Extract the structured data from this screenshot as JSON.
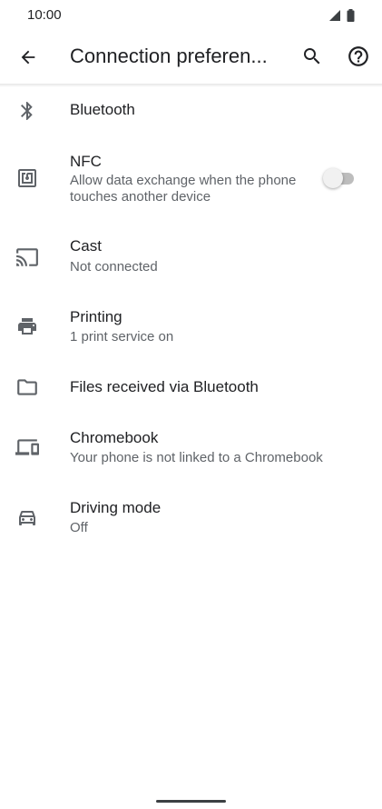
{
  "status_bar": {
    "time": "10:00"
  },
  "app_bar": {
    "title": "Connection preferen..."
  },
  "items": [
    {
      "title": "Bluetooth",
      "icon": "bluetooth-icon"
    },
    {
      "title": "NFC",
      "subtitle": "Allow data exchange when the phone touches another device",
      "icon": "nfc-icon",
      "toggle_on": false
    },
    {
      "title": "Cast",
      "subtitle": "Not connected",
      "icon": "cast-icon"
    },
    {
      "title": "Printing",
      "subtitle": "1 print service on",
      "icon": "printer-icon"
    },
    {
      "title": "Files received via Bluetooth",
      "icon": "folder-icon"
    },
    {
      "title": "Chromebook",
      "subtitle": "Your phone is not linked to a Chromebook",
      "icon": "devices-icon"
    },
    {
      "title": "Driving mode",
      "subtitle": "Off",
      "icon": "car-icon"
    }
  ],
  "colors": {
    "text_primary": "#202124",
    "text_secondary": "#5f6368",
    "icon": "#5f6368"
  }
}
